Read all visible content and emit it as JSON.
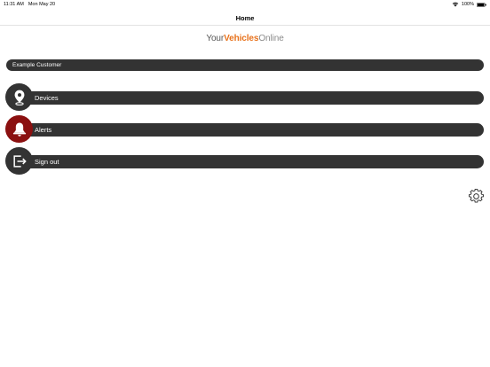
{
  "status": {
    "time": "11:31 AM",
    "date": "Mon May 20",
    "battery": "100%"
  },
  "nav": {
    "title": "Home"
  },
  "logo": {
    "part1": "Your",
    "part2": "Vehicles",
    "part3": "Online"
  },
  "customer": {
    "name": "Example Customer"
  },
  "menu": [
    {
      "label": "Devices",
      "icon": "location-pin-icon"
    },
    {
      "label": "Alerts",
      "icon": "bell-icon"
    },
    {
      "label": "Sign out",
      "icon": "sign-out-icon"
    }
  ],
  "colors": {
    "bar": "#333333",
    "alert": "#8b1010",
    "brand_orange": "#e8721c"
  },
  "settings": {
    "icon": "gear-icon"
  }
}
